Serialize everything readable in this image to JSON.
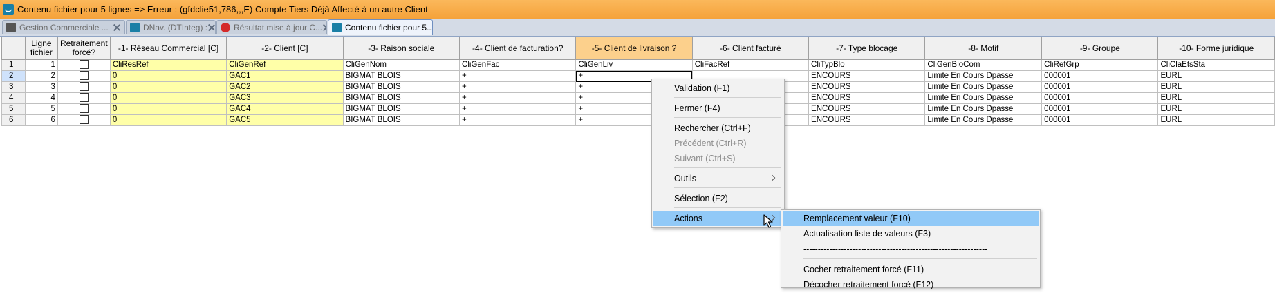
{
  "window": {
    "title": "Contenu fichier pour 5 lignes => Erreur : (gfdclie51,786,,,E) Compte Tiers Déjà Affecté à un autre Client"
  },
  "tabs": [
    {
      "label": "Gestion Commerciale ...",
      "icon": "document-icon",
      "active": false
    },
    {
      "label": "DNav. (DTInteg) :",
      "icon": "wave-icon",
      "active": false
    },
    {
      "label": "Résultat mise à jour C...",
      "icon": "stop-icon",
      "active": false
    },
    {
      "label": "Contenu fichier pour 5...",
      "icon": "wave-icon",
      "active": true
    }
  ],
  "grid": {
    "headers": [
      "Ligne fichier",
      "Retraitement forcé?",
      "-1- Réseau Commercial [C]",
      "-2- Client [C]",
      "-3- Raison sociale",
      "-4- Client de facturation?",
      "-5- Client de livraison ?",
      "-6- Client facturé",
      "-7- Type blocage",
      "-8- Motif",
      "-9- Groupe",
      "-10- Forme juridique"
    ],
    "rows": [
      {
        "rownum": "1",
        "ligne": "1",
        "cells": [
          "CliResRef",
          "CliGenRef",
          "CliGenNom",
          "CliGenFac",
          "CliGenLiv",
          "CliFacRef",
          "CliTypBlo",
          "CliGenBloCom",
          "CliRefGrp",
          "CliClaEtsSta"
        ]
      },
      {
        "rownum": "2",
        "ligne": "2",
        "cells": [
          "0",
          "GAC1",
          "BIGMAT BLOIS",
          "+",
          "+",
          "",
          "ENCOURS",
          "Limite En Cours Dpasse",
          "000001",
          "EURL"
        ]
      },
      {
        "rownum": "3",
        "ligne": "3",
        "cells": [
          "0",
          "GAC2",
          "BIGMAT BLOIS",
          "+",
          "+",
          "",
          "ENCOURS",
          "Limite En Cours Dpasse",
          "000001",
          "EURL"
        ]
      },
      {
        "rownum": "4",
        "ligne": "4",
        "cells": [
          "0",
          "GAC3",
          "BIGMAT BLOIS",
          "+",
          "+",
          "",
          "ENCOURS",
          "Limite En Cours Dpasse",
          "000001",
          "EURL"
        ]
      },
      {
        "rownum": "5",
        "ligne": "5",
        "cells": [
          "0",
          "GAC4",
          "BIGMAT BLOIS",
          "+",
          "+",
          "",
          "ENCOURS",
          "Limite En Cours Dpasse",
          "000001",
          "EURL"
        ]
      },
      {
        "rownum": "6",
        "ligne": "6",
        "cells": [
          "0",
          "GAC5",
          "BIGMAT BLOIS",
          "+",
          "+",
          "",
          "ENCOURS",
          "Limite En Cours Dpasse",
          "000001",
          "EURL"
        ]
      }
    ]
  },
  "context_menu": {
    "items": [
      {
        "label": "Validation (F1)",
        "enabled": true
      },
      {
        "label": "Fermer (F4)",
        "enabled": true
      },
      {
        "label": "Rechercher (Ctrl+F)",
        "enabled": true
      },
      {
        "label": "Précédent (Ctrl+R)",
        "enabled": false
      },
      {
        "label": "Suivant (Ctrl+S)",
        "enabled": false
      },
      {
        "label": "Outils",
        "enabled": true,
        "submenu": true
      },
      {
        "label": "Sélection (F2)",
        "enabled": true
      },
      {
        "label": "Actions",
        "enabled": true,
        "submenu": true,
        "highlighted": true
      }
    ]
  },
  "submenu": {
    "items": [
      {
        "label": "Remplacement valeur  (F10)",
        "highlighted": true
      },
      {
        "label": "Actualisation liste de valeurs  (F3)"
      },
      {
        "label": "----------------------------------------------------------------"
      },
      {
        "label": "Cocher retraitement forcé  (F11)"
      },
      {
        "label": "Décocher retraitement forcé  (F12)"
      }
    ]
  },
  "colors": {
    "titlebar": "#f5a23a",
    "highlight_header": "#fcd08c",
    "yellow_cells": "#ffffa8",
    "menu_highlight": "#91c9f7"
  }
}
